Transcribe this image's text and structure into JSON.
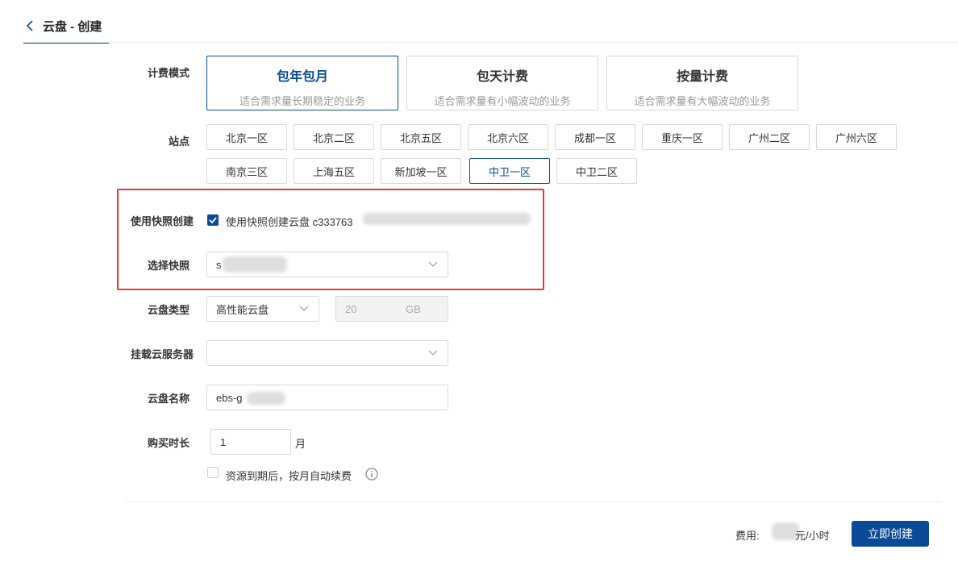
{
  "header": {
    "title": "云盘 - 创建"
  },
  "billing": {
    "label": "计费模式",
    "options": [
      {
        "title": "包年包月",
        "desc": "适合需求量长期稳定的业务",
        "selected": true
      },
      {
        "title": "包天计费",
        "desc": "适合需求量有小幅波动的业务",
        "selected": false
      },
      {
        "title": "按量计费",
        "desc": "适合需求量有大幅波动的业务",
        "selected": false
      }
    ]
  },
  "site": {
    "label": "站点",
    "row1": [
      "北京一区",
      "北京二区",
      "北京五区",
      "北京六区",
      "成都一区",
      "重庆一区",
      "广州二区",
      "广州六区"
    ],
    "row2": [
      "南京三区",
      "上海五区",
      "新加坡一区",
      "中卫一区",
      "中卫二区"
    ],
    "selected": "中卫一区"
  },
  "snapshot": {
    "use_label": "使用快照创建",
    "checkbox_text": "使用快照创建云盘 c333763",
    "checked": true,
    "select_label": "选择快照",
    "select_value": "s"
  },
  "disk_type": {
    "label": "云盘类型",
    "value": "高性能云盘",
    "size": "20",
    "unit": "GB"
  },
  "mount": {
    "label": "挂载云服务器",
    "value": ""
  },
  "disk_name": {
    "label": "云盘名称",
    "value": "ebs-g"
  },
  "duration": {
    "label": "购买时长",
    "value": "1",
    "unit": "月"
  },
  "auto_renew": {
    "text": "资源到期后，按月自动续费",
    "checked": false
  },
  "footer": {
    "fee_label": "费用:",
    "fee_unit": "元/小时",
    "create_label": "立即创建"
  },
  "colors": {
    "primary": "#0a4a96",
    "highlight": "#e53935"
  }
}
